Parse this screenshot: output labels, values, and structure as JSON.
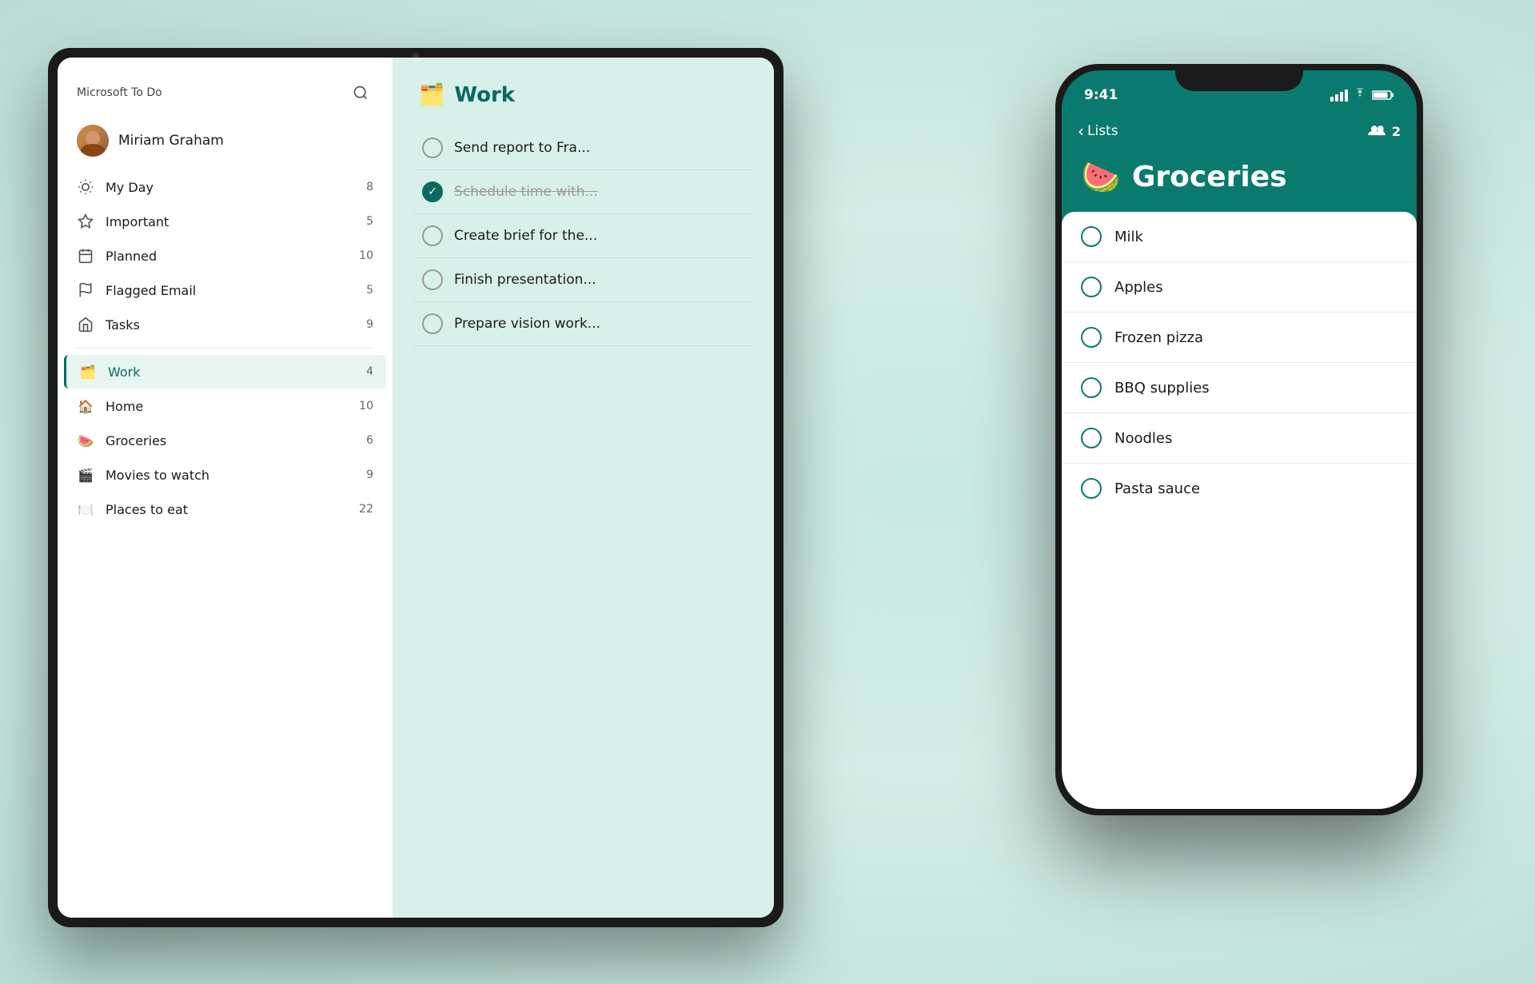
{
  "app": {
    "name": "Microsoft To Do"
  },
  "tablet": {
    "sidebar": {
      "title": "Microsoft To Do",
      "user": {
        "name": "Miriam Graham"
      },
      "nav_items": [
        {
          "id": "my-day",
          "label": "My Day",
          "count": "8",
          "icon": "sun"
        },
        {
          "id": "important",
          "label": "Important",
          "count": "5",
          "icon": "star"
        },
        {
          "id": "planned",
          "label": "Planned",
          "count": "10",
          "icon": "calendar"
        },
        {
          "id": "flagged-email",
          "label": "Flagged Email",
          "count": "5",
          "icon": "flag"
        },
        {
          "id": "tasks",
          "label": "Tasks",
          "count": "9",
          "icon": "home"
        }
      ],
      "lists": [
        {
          "id": "work",
          "label": "Work",
          "count": "4",
          "icon": "work",
          "active": true
        },
        {
          "id": "home",
          "label": "Home",
          "count": "10",
          "icon": "home2"
        },
        {
          "id": "groceries",
          "label": "Groceries",
          "count": "6",
          "icon": "watermelon"
        },
        {
          "id": "movies",
          "label": "Movies to watch",
          "count": "9",
          "icon": "popcorn"
        },
        {
          "id": "places",
          "label": "Places to eat",
          "count": "22",
          "icon": "food"
        }
      ]
    },
    "main": {
      "list_icon": "🗂️",
      "title": "Work",
      "tasks": [
        {
          "id": "task1",
          "text": "Send report to Fra...",
          "completed": false
        },
        {
          "id": "task2",
          "text": "Schedule time with...",
          "completed": true
        },
        {
          "id": "task3",
          "text": "Create brief for the...",
          "completed": false
        },
        {
          "id": "task4",
          "text": "Finish presentation...",
          "completed": false
        },
        {
          "id": "task5",
          "text": "Prepare vision work...",
          "completed": false
        }
      ]
    }
  },
  "phone": {
    "status_bar": {
      "time": "9:41"
    },
    "nav": {
      "back_label": "Lists",
      "shared_count": "2"
    },
    "list": {
      "emoji": "🍉",
      "title": "Groceries",
      "items": [
        {
          "id": "milk",
          "text": "Milk"
        },
        {
          "id": "apples",
          "text": "Apples"
        },
        {
          "id": "frozen-pizza",
          "text": "Frozen pizza"
        },
        {
          "id": "bbq",
          "text": "BBQ supplies"
        },
        {
          "id": "noodles",
          "text": "Noodles"
        },
        {
          "id": "pasta-sauce",
          "text": "Pasta sauce"
        }
      ]
    }
  }
}
